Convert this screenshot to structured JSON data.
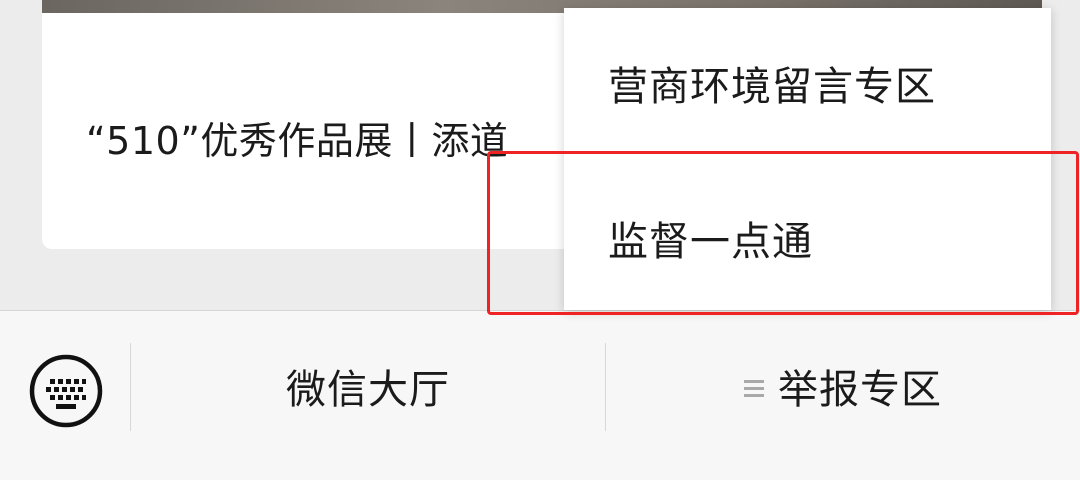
{
  "article": {
    "title": "“510”优秀作品展丨添道"
  },
  "popup_menu": {
    "items": [
      {
        "label": "营商环境留言专区"
      },
      {
        "label": "监督一点通"
      }
    ]
  },
  "bottom_bar": {
    "keyboard_icon": "keyboard-icon",
    "tabs": [
      {
        "label": "微信大厅"
      },
      {
        "label": "举报专区",
        "icon": "menu-lines-icon"
      }
    ]
  },
  "colors": {
    "highlight": "#ee2424",
    "background": "#ececec",
    "bar_background": "#f7f7f7"
  }
}
